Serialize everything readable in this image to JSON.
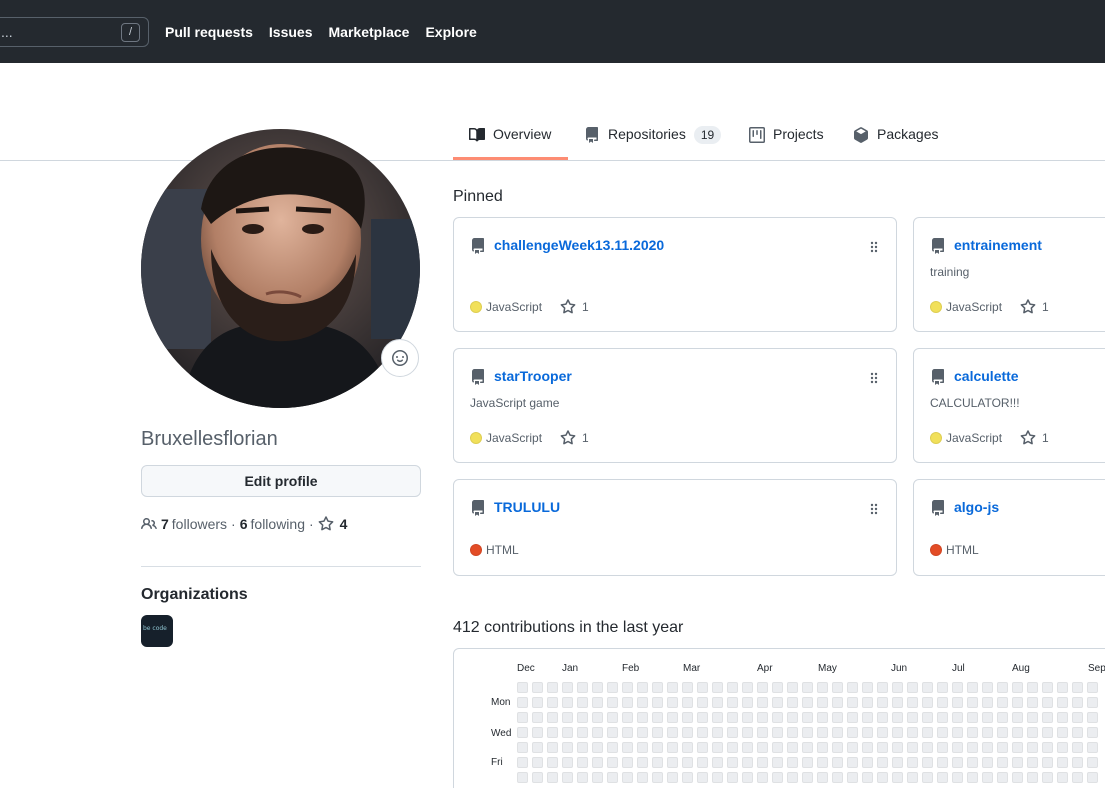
{
  "header": {
    "search_placeholder": "...",
    "search_shortcut": "/",
    "nav": [
      "Pull requests",
      "Issues",
      "Marketplace",
      "Explore"
    ]
  },
  "tabs": [
    {
      "label": "Overview",
      "icon": "book-icon",
      "active": true
    },
    {
      "label": "Repositories",
      "icon": "repo-icon",
      "count": "19"
    },
    {
      "label": "Projects",
      "icon": "project-icon"
    },
    {
      "label": "Packages",
      "icon": "package-icon"
    }
  ],
  "profile": {
    "username": "Bruxellesflorian",
    "edit_label": "Edit profile",
    "followers_count": "7",
    "followers_label": "followers",
    "separator": "·",
    "following_count": "6",
    "following_label": "following",
    "stars_count": "4",
    "organizations_title": "Organizations",
    "org_logo_text": "be code"
  },
  "pinned": {
    "title": "Pinned",
    "repos": [
      {
        "name": "challengeWeek13.11.2020",
        "description": "",
        "language": "JavaScript",
        "lang_color": "#f1e05a",
        "stars": "1"
      },
      {
        "name": "entrainement",
        "description": "training",
        "language": "JavaScript",
        "lang_color": "#f1e05a",
        "stars": "1"
      },
      {
        "name": "starTrooper",
        "description": "JavaScript game",
        "language": "JavaScript",
        "lang_color": "#f1e05a",
        "stars": "1"
      },
      {
        "name": "calculette",
        "description": "CALCULATOR!!!",
        "language": "JavaScript",
        "lang_color": "#f1e05a",
        "stars": "1"
      },
      {
        "name": "TRULULU",
        "description": "",
        "language": "HTML",
        "lang_color": "#e34c26",
        "stars": ""
      },
      {
        "name": "algo-js",
        "description": "",
        "language": "HTML",
        "lang_color": "#e34c26",
        "stars": ""
      }
    ]
  },
  "contributions": {
    "title": "412 contributions in the last year",
    "months": [
      "Dec",
      "Jan",
      "Feb",
      "Mar",
      "Apr",
      "May",
      "Jun",
      "Jul",
      "Aug",
      "Sep"
    ],
    "days": [
      "Mon",
      "Wed",
      "Fri"
    ]
  },
  "colors": {
    "header_bg": "#24292f",
    "link": "#0969da",
    "tab_underline": "#fd8c73",
    "javascript": "#f1e05a",
    "html": "#e34c26"
  }
}
